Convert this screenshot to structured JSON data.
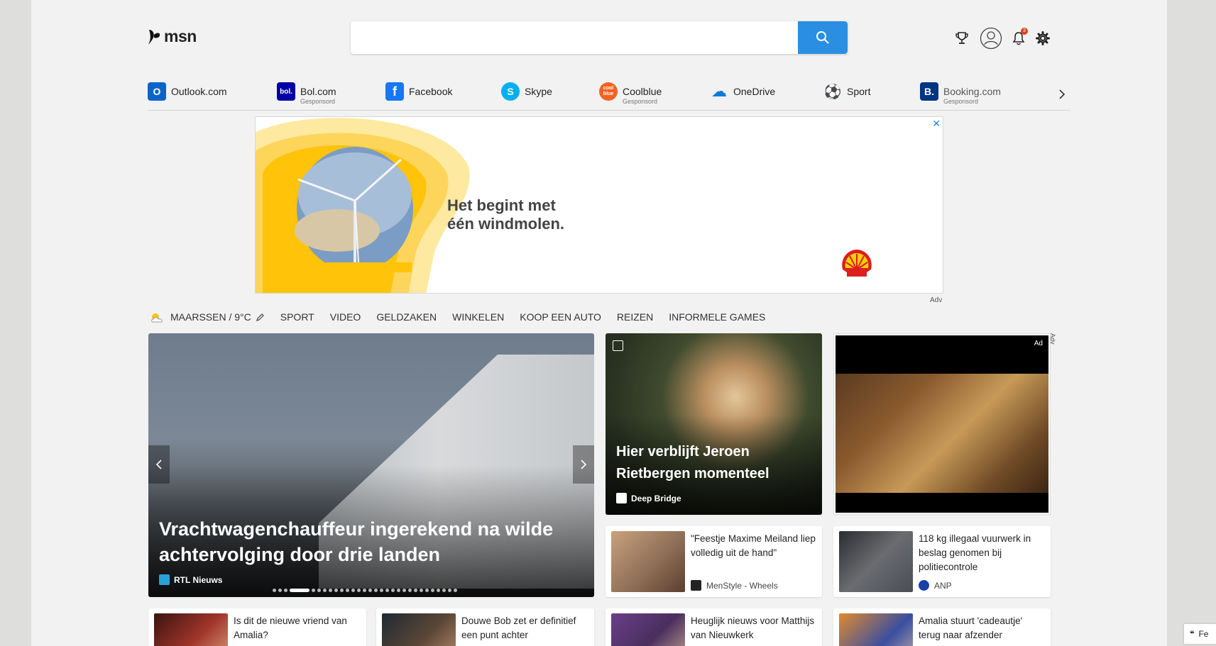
{
  "header": {
    "logo_text": "msn",
    "search_placeholder": "",
    "notification_count": "3"
  },
  "quicklinks": [
    {
      "label": "Outlook.com",
      "sub": "",
      "icon": "outlook-icon",
      "color": "#0a64c8",
      "glyph": "O"
    },
    {
      "label": "Bol.com",
      "sub": "Gesponsord",
      "icon": "bol-icon",
      "color": "#0000a4",
      "glyph": "bol."
    },
    {
      "label": "Facebook",
      "sub": "",
      "icon": "facebook-icon",
      "color": "#1877f2",
      "glyph": "f"
    },
    {
      "label": "Skype",
      "sub": "",
      "icon": "skype-icon",
      "color": "#00aff0",
      "glyph": "S"
    },
    {
      "label": "Coolblue",
      "sub": "Gesponsord",
      "icon": "coolblue-icon",
      "color": "#f26322",
      "glyph": "cool blue"
    },
    {
      "label": "OneDrive",
      "sub": "",
      "icon": "onedrive-icon",
      "color": "#0f78d4",
      "glyph": "☁"
    },
    {
      "label": "Sport",
      "sub": "",
      "icon": "sport-icon",
      "color": "#3b4a8a",
      "glyph": "⚽"
    },
    {
      "label": "Booking.com",
      "sub": "Gesponsord",
      "icon": "booking-icon",
      "color": "#003580",
      "glyph": "B."
    }
  ],
  "ad": {
    "headline": "Het begint met\néén windmolen.",
    "label": "Adv",
    "close": "✕"
  },
  "nav": {
    "weather": "MAARSSEN / 9°C",
    "items": [
      "SPORT",
      "VIDEO",
      "GELDZAKEN",
      "WINKELEN",
      "KOOP EEN AUTO",
      "REIZEN",
      "INFORMELE GAMES"
    ]
  },
  "hero": {
    "title": "Vrachtwagenchauffeur ingerekend na wilde achtervolging door drie landen",
    "source": "RTL Nieuws",
    "source_color": "#2aa0d8",
    "active_dot_index": 3,
    "dot_count": 30
  },
  "feature": {
    "title": "Hier verblijft Jeroen Rietbergen momenteel",
    "source": "Deep Bridge"
  },
  "video_ad": {
    "label": "Ad",
    "side_label": "Adv"
  },
  "cards": [
    {
      "title": "\"Feestje Maxime Meiland liep volledig uit de hand\"",
      "source": "MenStyle - Wheels",
      "thumb": "#8a6b54",
      "src_color": "#222"
    },
    {
      "title": "118 kg illegaal vuurwerk in beslag genomen bij politiecontrole",
      "source": "ANP",
      "thumb": "#4a4d55",
      "src_color": "#1a3fa8"
    },
    {
      "title": "Is dit de nieuwe vriend van Amalia?",
      "source": "",
      "thumb": "#7a2a22",
      "src_color": "#999"
    },
    {
      "title": "Douwe Bob zet er definitief een punt achter",
      "source": "",
      "thumb": "#5b4636",
      "src_color": "#999"
    },
    {
      "title": "Heuglijk nieuws voor Matthijs van Nieuwkerk",
      "source": "",
      "thumb": "#4a2f5e",
      "src_color": "#999"
    },
    {
      "title": "Amalia stuurt 'cadeautje' terug naar afzender",
      "source": "",
      "thumb": "#d27b2a",
      "src_color": "#999"
    }
  ],
  "feedback": {
    "label": "Fe"
  }
}
